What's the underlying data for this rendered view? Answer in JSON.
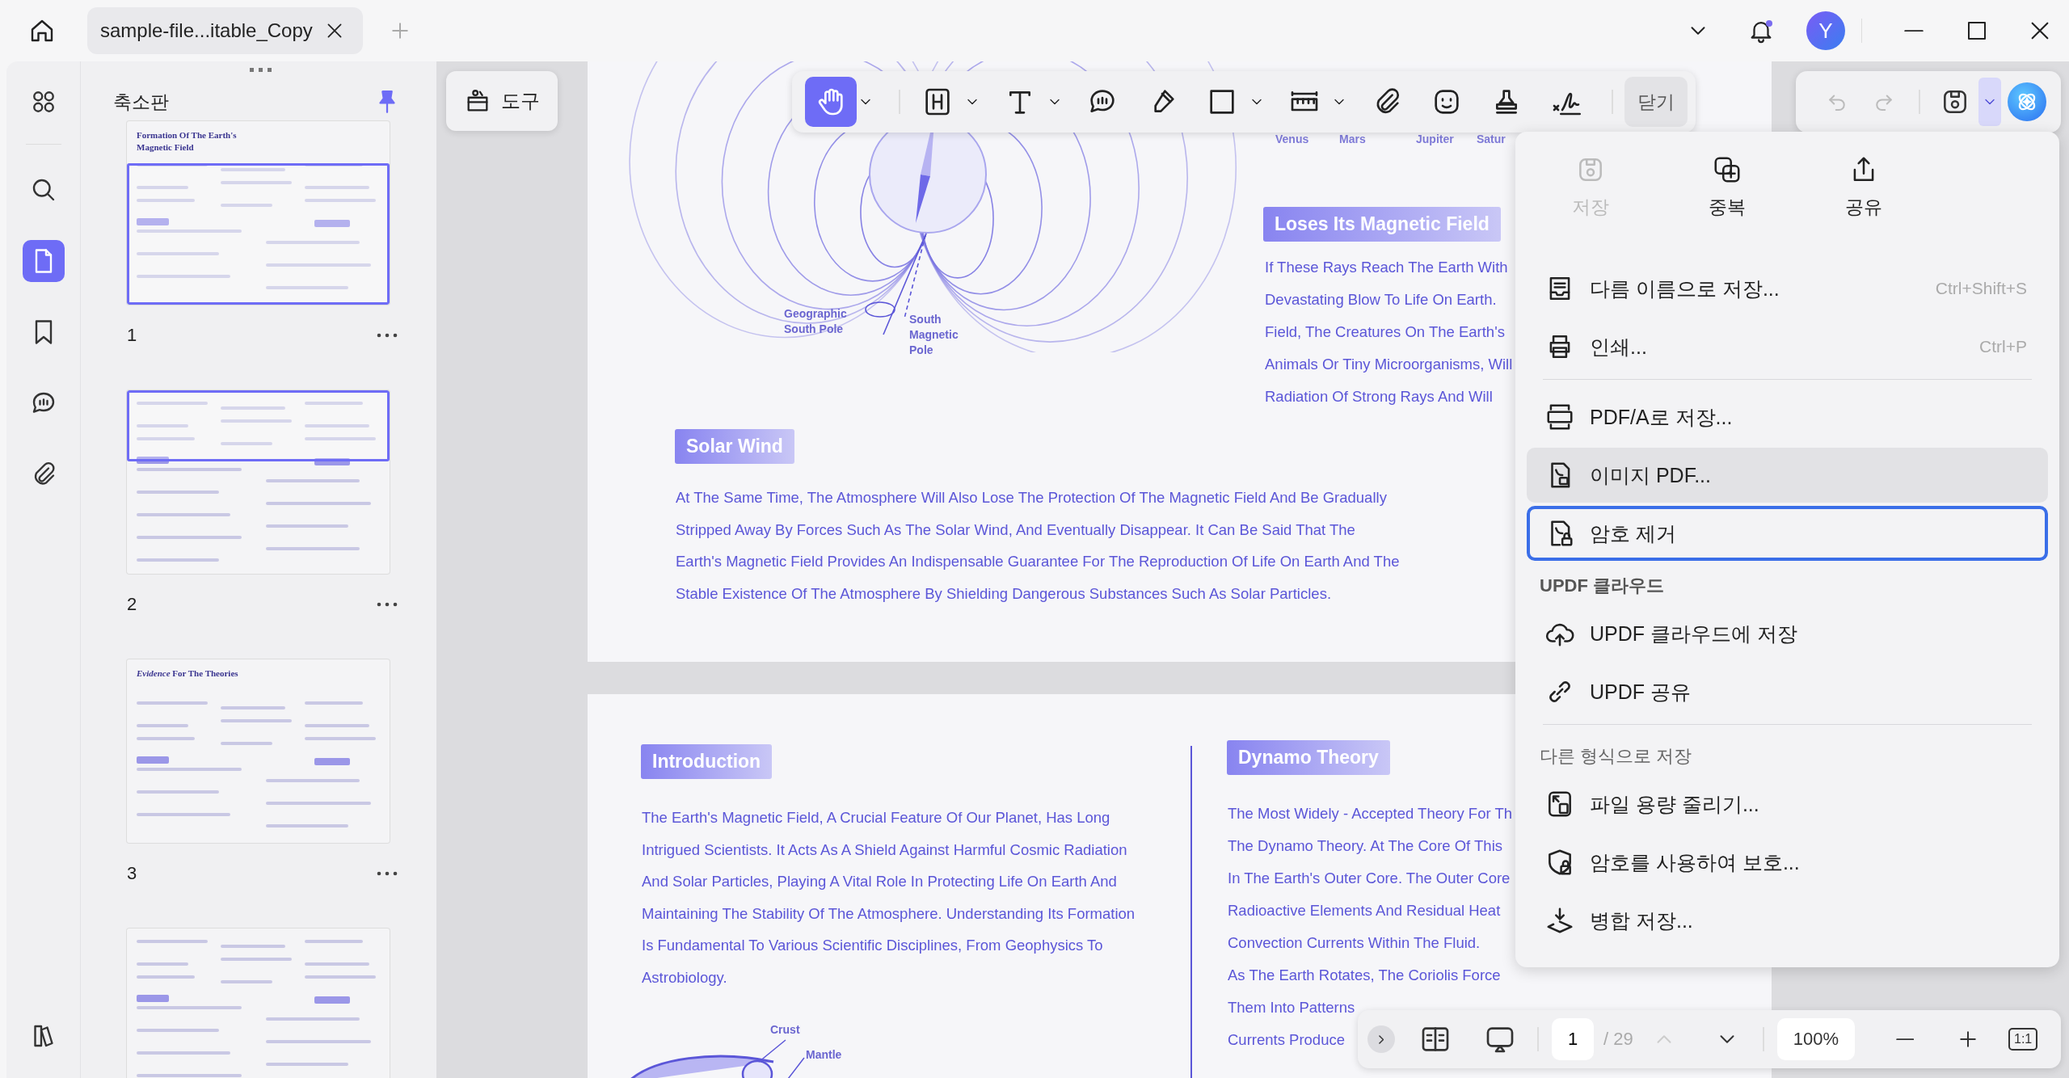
{
  "tab_bar": {
    "tabs": [
      {
        "title": "sample-file...itable_Copy",
        "selected": true
      }
    ],
    "avatar": "Y",
    "notification": true
  },
  "rail": {
    "items": [
      {
        "selected": false
      },
      {
        "selected": false
      },
      {
        "selected": true
      },
      {
        "selected": false
      },
      {
        "selected": false
      },
      {
        "selected": false
      },
      {
        "selected": false
      }
    ]
  },
  "thumbnails": {
    "title": "축소판",
    "pinned": true,
    "pages": [
      {
        "number": "1",
        "heading": "Formation Of The Earth's Magnetic Field",
        "in_view": true
      },
      {
        "number": "2",
        "in_view": true
      },
      {
        "number": "3",
        "heading": "*Evidence* For The Theories",
        "in_view": false
      },
      {
        "in_view": false
      }
    ]
  },
  "tools_button": {
    "label": "도구"
  },
  "toolbar": {
    "tools": [
      {
        "selected": true,
        "dropdown": true
      },
      {
        "selected": false,
        "dropdown": true
      },
      {
        "selected": false,
        "dropdown": true
      },
      {
        "selected": false,
        "dropdown": false
      },
      {
        "selected": false,
        "dropdown": false
      },
      {
        "selected": false,
        "dropdown": true
      },
      {
        "selected": false,
        "dropdown": true
      },
      {
        "selected": false,
        "dropdown": false
      },
      {
        "selected": false,
        "dropdown": false
      },
      {
        "selected": false,
        "dropdown": false
      },
      {
        "selected": false,
        "dropdown": false
      }
    ],
    "close": "닫기"
  },
  "history": {
    "undo_disabled": true,
    "redo_disabled": true,
    "save_menu_open": true
  },
  "document": {
    "page_1": {
      "planet_labels": [
        "Venus",
        "Mars",
        "Jupiter",
        "Satur"
      ],
      "diagram_labels": [
        "Geographic South Pole",
        "South Magnetic Pole"
      ],
      "field_section": {
        "heading": "Loses Its Magnetic Field",
        "lines": [
          "If These Rays Reach The Earth With",
          "Devastating Blow To Life On Earth.",
          "Field, The Creatures On The Earth's",
          "Animals Or Tiny Microorganisms, Will",
          "Radiation Of Strong Rays And Will"
        ]
      },
      "wind_section": {
        "heading": "Solar Wind",
        "text": "At The Same Time, The Atmosphere Will Also Lose The Protection Of The Magnetic Field And Be Gradually Stripped Away By Forces Such As The Solar Wind, And Eventually Disappear. It Can Be Said That The Earth's Magnetic Field Provides An Indispensable Guarantee For The Reproduction Of Life On Earth And The Stable Existence Of The Atmosphere By Shielding Dangerous Substances Such As Solar Particles."
      }
    },
    "page_2": {
      "intro_section": {
        "heading": "Introduction",
        "text": "The Earth's Magnetic Field, A Crucial Feature Of Our Planet, Has Long Intrigued Scientists. It Acts As A Shield Against Harmful Cosmic Radiation And Solar Particles, Playing A Vital Role In Protecting Life On Earth And Maintaining The Stability Of The Atmosphere. Understanding Its Formation Is Fundamental To Various Scientific Disciplines, From Geophysics To Astrobiology."
      },
      "layer_labels": [
        "Crust",
        "Mantle"
      ],
      "dynamo_section": {
        "heading": "Dynamo Theory",
        "lines": [
          "The Most Widely - Accepted Theory For Th",
          "The Dynamo Theory. At The Core Of This",
          "In The Earth's Outer Core. The Outer Core",
          "Radioactive Elements And Residual Heat",
          "Convection Currents Within The Fluid.",
          "As The Earth Rotates, The Coriolis Force",
          "Them Into Patterns",
          "Currents Produce"
        ]
      }
    }
  },
  "save_menu": {
    "top": [
      {
        "label": "저장",
        "disabled": true
      },
      {
        "label": "중복",
        "disabled": false
      },
      {
        "label": "공유",
        "disabled": false
      }
    ],
    "entries": [
      {
        "kind": "item",
        "label": "다름 이름으로 저장...",
        "shortcut": "Ctrl+Shift+S",
        "hovered": false,
        "focused": false
      },
      {
        "kind": "item",
        "label": "인쇄...",
        "shortcut": "Ctrl+P",
        "hovered": false,
        "focused": false
      },
      {
        "kind": "divider"
      },
      {
        "kind": "item",
        "label": "PDF/A로 저장...",
        "hovered": false,
        "focused": false
      },
      {
        "kind": "item",
        "label": "이미지 PDF...",
        "hovered": true,
        "focused": false
      },
      {
        "kind": "item",
        "label": "암호 제거",
        "hovered": false,
        "focused": true
      },
      {
        "kind": "header",
        "label": "UPDF 클라우드"
      },
      {
        "kind": "item",
        "label": "UPDF 클라우드에 저장",
        "hovered": false,
        "focused": false
      },
      {
        "kind": "item",
        "label": "UPDF 공유",
        "hovered": false,
        "focused": false
      },
      {
        "kind": "divider"
      },
      {
        "kind": "header",
        "label": "다른 형식으로 저장"
      },
      {
        "kind": "item",
        "label": "파일 용량 줄리기...",
        "hovered": false,
        "focused": false
      },
      {
        "kind": "item",
        "label": "암호를 사용하여 보호...",
        "hovered": false,
        "focused": false
      },
      {
        "kind": "item",
        "label": "병합 저장...",
        "hovered": false,
        "focused": false
      }
    ]
  },
  "page_nav": {
    "page": "1",
    "total": "/ 29",
    "previous_disabled": true,
    "zoom": "100%",
    "fit": "1:1"
  }
}
